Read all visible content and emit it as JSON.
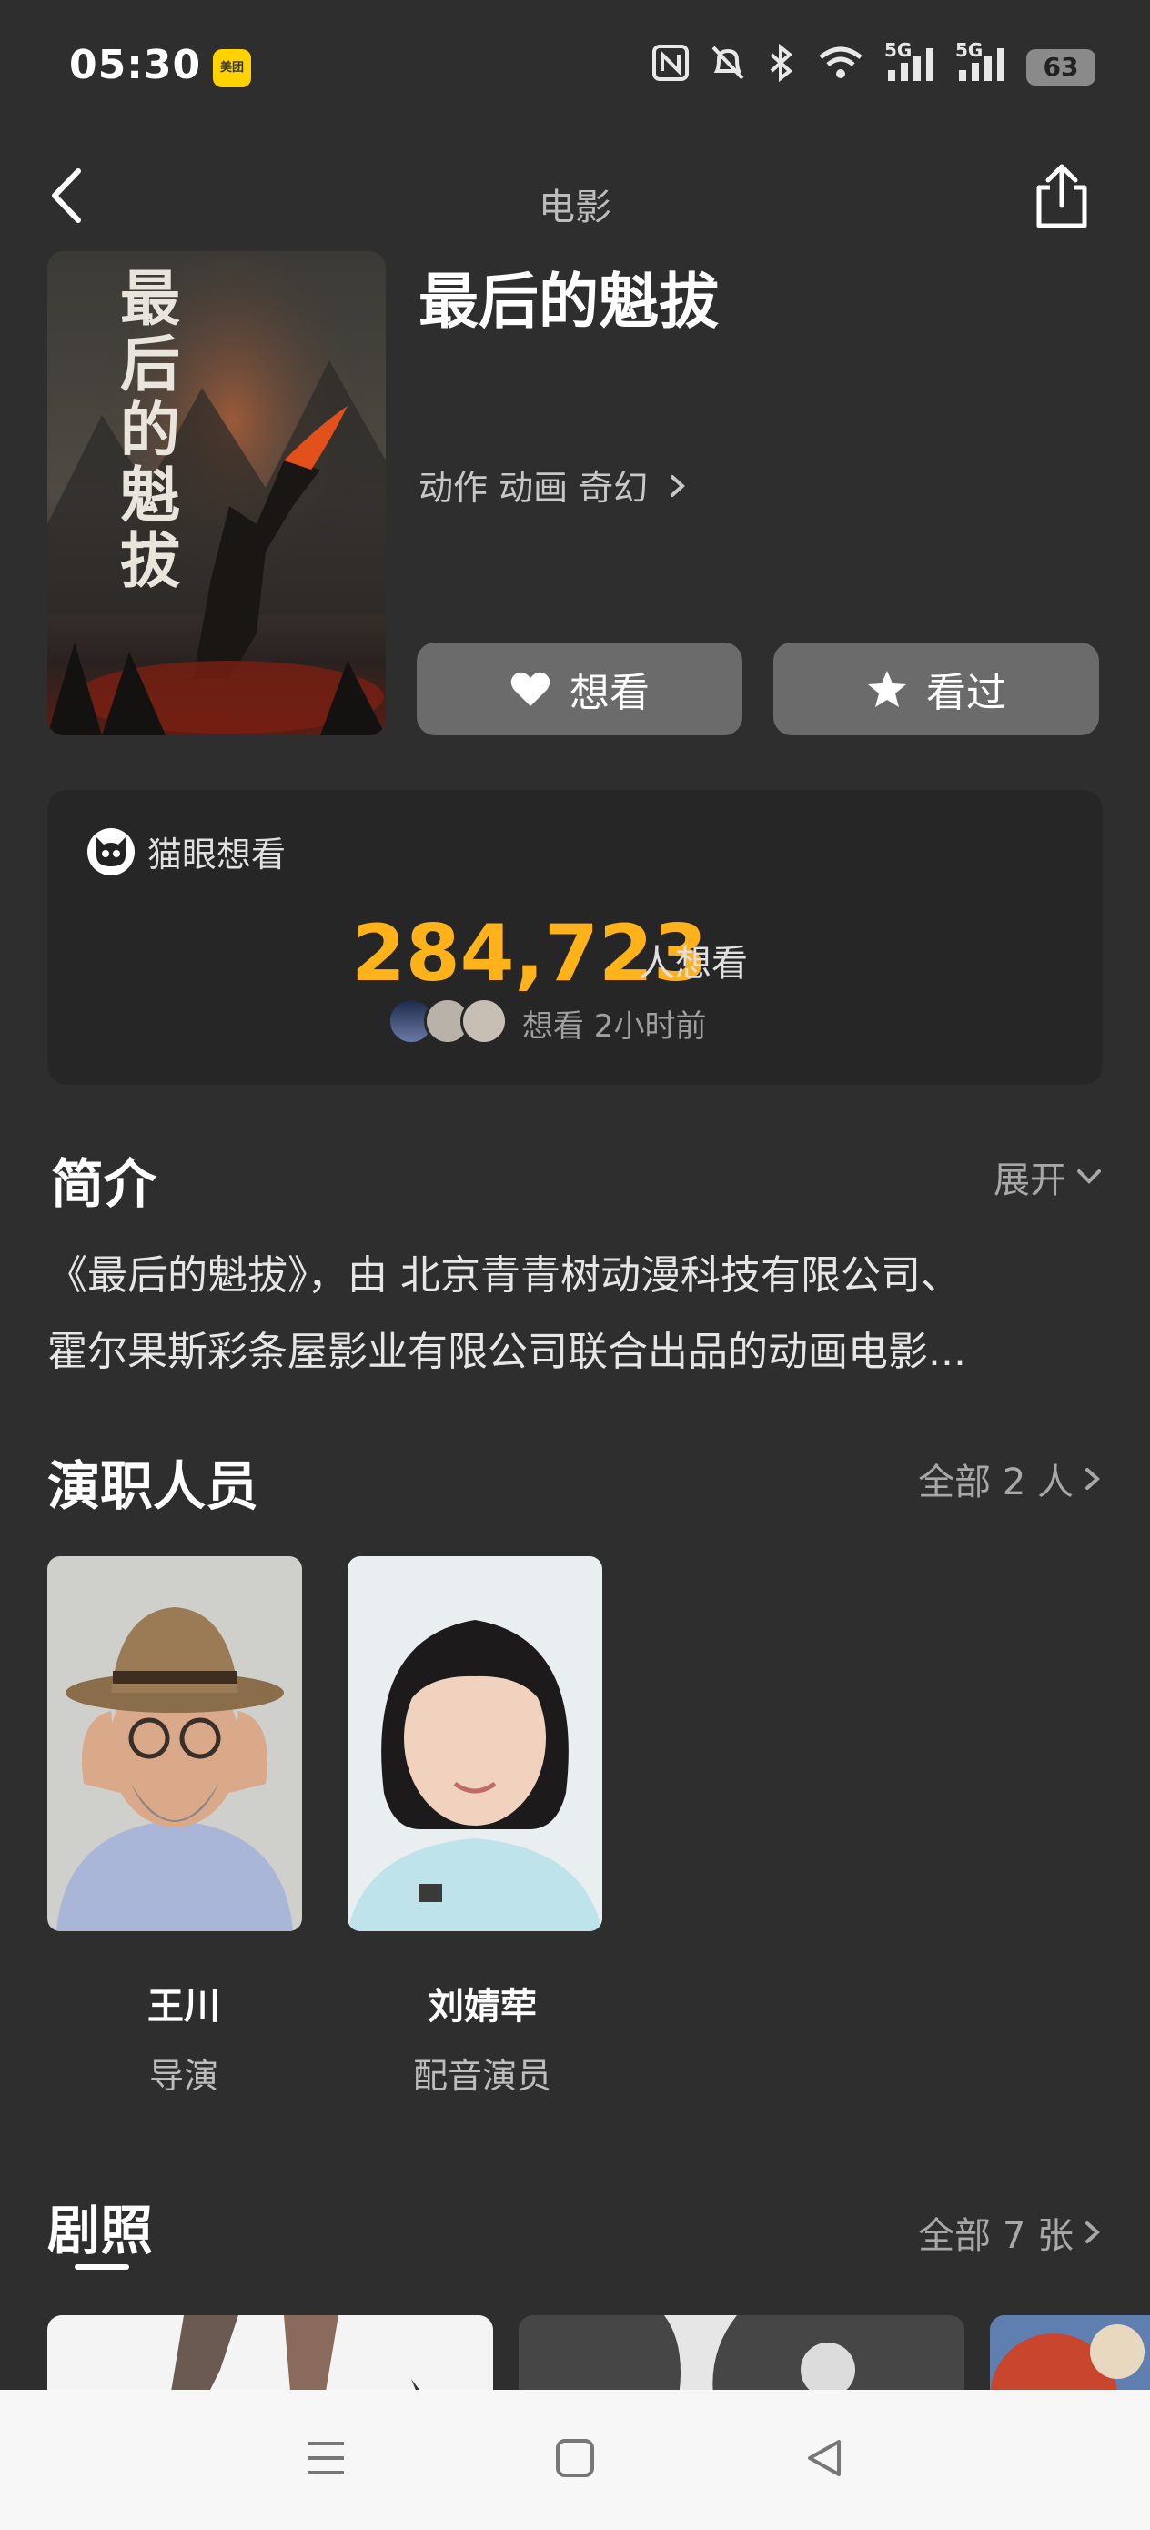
{
  "status_bar": {
    "time": "05:30",
    "app_badge": "美团",
    "battery": "63",
    "signal_1": "5G",
    "signal_2": "5G"
  },
  "header": {
    "title": "电影"
  },
  "movie": {
    "title": "最后的魁拔",
    "genres": "动作 动画 奇幻",
    "poster_text": "最后的魁拔"
  },
  "actions": {
    "want_label": "想看",
    "watched_label": "看过"
  },
  "wish": {
    "label": "猫眼想看",
    "count": "284,723",
    "unit": "人想看",
    "recent": "想看  2小时前"
  },
  "synopsis": {
    "title": "简介",
    "expand_label": "展开",
    "line1": "《最后的魁拔》，由 北京青青树动漫科技有限公司、",
    "line2": "霍尔果斯彩条屋影业有限公司联合出品的动画电影..."
  },
  "cast": {
    "title": "演职人员",
    "all_label": "全部 2 人",
    "members": [
      {
        "name": "王川",
        "role": "导演"
      },
      {
        "name": "刘婧荦",
        "role": "配音演员"
      }
    ]
  },
  "photos": {
    "title": "剧照",
    "all_label": "全部 7 张"
  },
  "colors": {
    "background": "#2e2e2e",
    "accent": "#ffb21a",
    "button": "#6b6b6b"
  }
}
